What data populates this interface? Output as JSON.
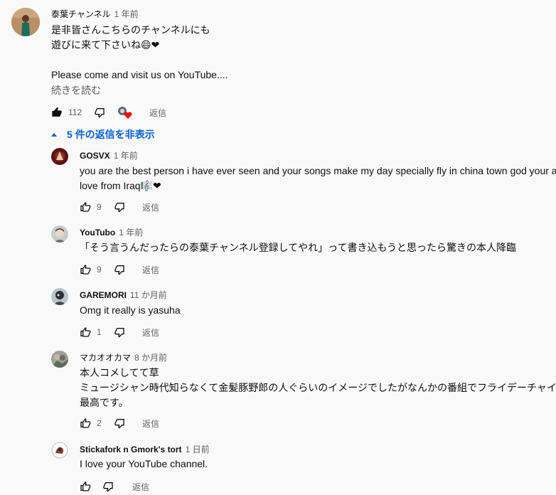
{
  "top_comment": {
    "author": "泰葉チャンネル",
    "time": "1 年前",
    "line1": "是非皆さんこちらのチャンネルにも",
    "line2": "遊びに来て下さいね😄❤",
    "line3": "Please come and visit us on YouTube....",
    "read_more": "続きを読む",
    "likes": "112",
    "reply_label": "返信"
  },
  "replies_toggle": {
    "label": "5 件の返信を非表示"
  },
  "replies": [
    {
      "author": "GOSVX",
      "time": "1 年前",
      "lines": [
        "you are the best person i have ever seen and your songs make my day specially fly in china town god your an",
        "love from Iraq🎼❤"
      ],
      "likes": "9",
      "reply_label": "返信"
    },
    {
      "author": "YouTubo",
      "time": "1 年前",
      "lines": [
        "「そう言うんだったらの泰葉チャンネル登録してやれ」って書き込もうと思ったら驚きの本人降臨"
      ],
      "likes": "9",
      "reply_label": "返信"
    },
    {
      "author": "GAREMORI",
      "time": "11 か月前",
      "lines": [
        "Omg it really is yasuha"
      ],
      "likes": "1",
      "reply_label": "返信"
    },
    {
      "author": "マカオオカマ",
      "time": "8 か月前",
      "lines": [
        "本人コメしてて草",
        "ミュージシャン時代知らなくて金髪豚野郎の人ぐらいのイメージでしたがなんかの番組でフライデーチャイ",
        "最高です。"
      ],
      "likes": "2",
      "reply_label": "返信"
    },
    {
      "author": "Stickafork n Gmork's tort",
      "time": "1 日前",
      "lines": [
        "I love your YouTube channel."
      ],
      "likes": "",
      "reply_label": "返信"
    }
  ]
}
